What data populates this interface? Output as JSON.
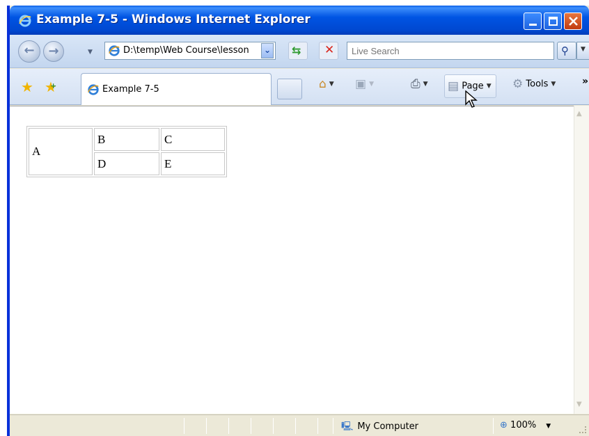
{
  "window": {
    "title": "Example 7-5 - Windows Internet Explorer"
  },
  "address_bar": {
    "url": "D:\\temp\\Web Course\\lesson"
  },
  "search": {
    "placeholder": "Live Search"
  },
  "tab": {
    "label": "Example 7-5"
  },
  "toolbar": {
    "page_label": "Page",
    "tools_label": "Tools",
    "more": "»"
  },
  "content": {
    "table": {
      "rows": [
        [
          "A",
          "B",
          "C"
        ],
        [
          "D",
          "E"
        ]
      ]
    }
  },
  "statusbar": {
    "zone": "My Computer",
    "zoom": "100%"
  },
  "icons": {
    "title": "ie-logo-icon",
    "back": "back-arrow-icon",
    "forward": "forward-arrow-icon",
    "refresh": "refresh-icon",
    "stop": "stop-icon",
    "search": "search-icon",
    "favorites": "favorites-star-icon",
    "add_favorite": "add-favorite-icon",
    "home": "home-icon",
    "feeds": "feeds-icon",
    "print": "print-icon",
    "page": "page-icon",
    "tools": "gear-icon",
    "zone": "computer-icon",
    "zoom": "zoom-icon"
  }
}
